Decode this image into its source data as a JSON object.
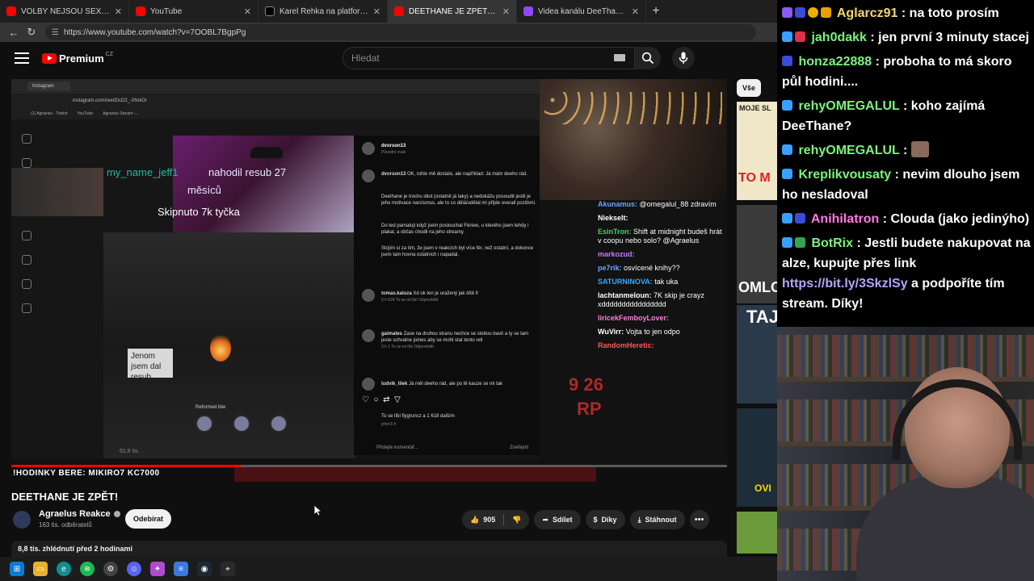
{
  "browser": {
    "tabs": [
      {
        "title": "VOLBY NEJSOU SEXY, Z NICH NE",
        "color": "#ff0000",
        "active": false
      },
      {
        "title": "YouTube",
        "color": "#ff0000",
        "active": false
      },
      {
        "title": "Karel Řehka na platformě X: „Po v",
        "color": "#ffffff",
        "active": false
      },
      {
        "title": "DEETHANE JE ZPĚT! - YouTube",
        "color": "#ff0000",
        "active": true
      },
      {
        "title": "Videa kanálu DeeThane - Twitch",
        "color": "#9146ff",
        "active": false
      }
    ],
    "url": "https://www.youtube.com/watch?v=7OOBL7BgpPg"
  },
  "youtube": {
    "logo_text": "Premium",
    "region": "CZ",
    "search_placeholder": "Hledat",
    "chips": [
      "Vše"
    ],
    "video": {
      "title": "DEETHANE JE ZPĚT!",
      "channel": "Agraelus Reakce",
      "subscribers": "163 tis. odběratelů",
      "subscribe_label": "Odebírat",
      "likes": "905",
      "share_label": "Sdílet",
      "thanks_label": "Díky",
      "download_label": "Stáhnout",
      "views_time": "8,8 tis. zhlédnutí  před 2 hodinami",
      "progress": 0.32
    }
  },
  "embedded": {
    "ig_tab": "Instagram",
    "ig_url": "instagram.com/reel/DcD2_-0NniO/",
    "bookmarks": [
      "(1) Agraelus - Twitch",
      "YouTube",
      "Agraelus Stream -..."
    ],
    "overlay_name": "my_name_jeff1",
    "overlay_sub": "nahodil resub 27",
    "overlay_months": "měsíců",
    "overlay_skip": "Skipnuto 7k tyčka",
    "speech": "Jenom jsem dal resub",
    "reformed": "Reformed btw",
    "comments": {
      "author": "dvorson13",
      "sound": "Původní zvuk",
      "caption_user": "dvorson13",
      "caption": "OK, tohle mě dostalo, ale například: Já mám deeho rád.",
      "p1": "Deethane je trochu idiot (ostatně já taky) a nedokážu posoudit jestli je jeho motivace narcismus, ale to co dělá/udělal mi přijde overall pozitivní.",
      "p2": "Do ted pamatuji když jsem poslouchal Fénixe, u kterého jsem tehdy i plakal, a občas chodil na jeho streamy.",
      "p3": "Stojím si za tím, že jsem v reakcích byl více fér, než ostatní, a dokonce jsem tam hovna ostatních i napadal.",
      "c1_user": "tomas.kaluza",
      "c1": "Xd ok ten je uražený jak dítě fr",
      "c1_meta": "5 h   624 To se mi líbí   Odpovědět",
      "c2_user": "gaimates",
      "c2": "Zase na druhou stranu nechce se stebou bavit a ty se tam jeste schvalne joines aby se mohl stat tento rell",
      "c2_meta": "3 h   1 To se mi líbí   Odpovědět",
      "c3_user": "ludvik_lilek",
      "c3": "Já měl deeho rád, ale po tě kauze se mi tak",
      "likes_line": "To se líbí flygruncz a 1 618 dalším",
      "time": "před 6 h",
      "add_comment": "Přidejte komentář...",
      "publish": "Zveřejnit",
      "views_small": "61,8 tis."
    },
    "chat_overlay": [
      {
        "user": "Akunamus:",
        "text": "@omegalul_88 zdravím",
        "color": "#6aa6ff"
      },
      {
        "user": "Niekselt:",
        "text": "",
        "color": "#ffffff"
      },
      {
        "user": "EsinTron:",
        "text": "Shift at midnight budeš hrát v coopu nebo solo? @Agraelus",
        "color": "#3fd16a"
      },
      {
        "user": "markozud:",
        "text": "",
        "color": "#c37bff"
      },
      {
        "user": "pe7rik:",
        "text": "osvícené knihy??",
        "color": "#6aa6ff"
      },
      {
        "user": "SATURNINOVA:",
        "text": "tak uka",
        "color": "#3aa8ff"
      },
      {
        "user": "lachtanmeloun:",
        "text": "7K skip je crayz xdddddddddddddddd",
        "color": "#ffffff"
      },
      {
        "user": "liricekFemboyLover:",
        "text": "",
        "color": "#ff7ad9"
      },
      {
        "user": "WuVirr:",
        "text": "Vojta to jen odpo",
        "color": "#ffffff"
      },
      {
        "user": "RandomHeretic:",
        "text": "",
        "color": "#ff5555"
      }
    ],
    "ticker": "!HODINKY BERE: MIKIRO7   KC7000",
    "overlay_num": "9 26",
    "overlay_rp": "RP"
  },
  "sidebar_recs": [
    "MOJE SL",
    "TO M",
    "OMLO",
    "TAJ",
    "OVI"
  ],
  "stream_chat": [
    {
      "user": "Aglarcz91",
      "text": "na toto prosím",
      "color": "#f5d76e"
    },
    {
      "user": "jah0dakk",
      "text": "jen první 3 minuty stacej",
      "color": "#7cf27c"
    },
    {
      "user": "honza22888",
      "text": "proboha to má skoro půl hodini....",
      "color": "#7cf27c"
    },
    {
      "user": "rehyOMEGALUL",
      "text": "koho zajímá DeeThane?",
      "color": "#7cf27c"
    },
    {
      "user": "rehyOMEGALUL",
      "text": "",
      "color": "#7cf27c"
    },
    {
      "user": "Kreplikvousaty",
      "text": "nevim dlouho jsem ho nesladoval",
      "color": "#7cf27c"
    },
    {
      "user": "Anihilatron",
      "text": "Clouda (jako jedinýho)",
      "color": "#ff7ae0"
    },
    {
      "user": "BotRix",
      "text": "Jestli budete nakupovat na alze, kupujte přes link",
      "color": "#7cf27c"
    }
  ],
  "stream_link": "https://bit.ly/3SkzlSy",
  "stream_link_after": "a podpoříte tím stream. Díky!",
  "colors": {
    "yt_red": "#ff0000",
    "twitch_purple": "#9146ff",
    "chat_link": "#b7a4ff"
  }
}
